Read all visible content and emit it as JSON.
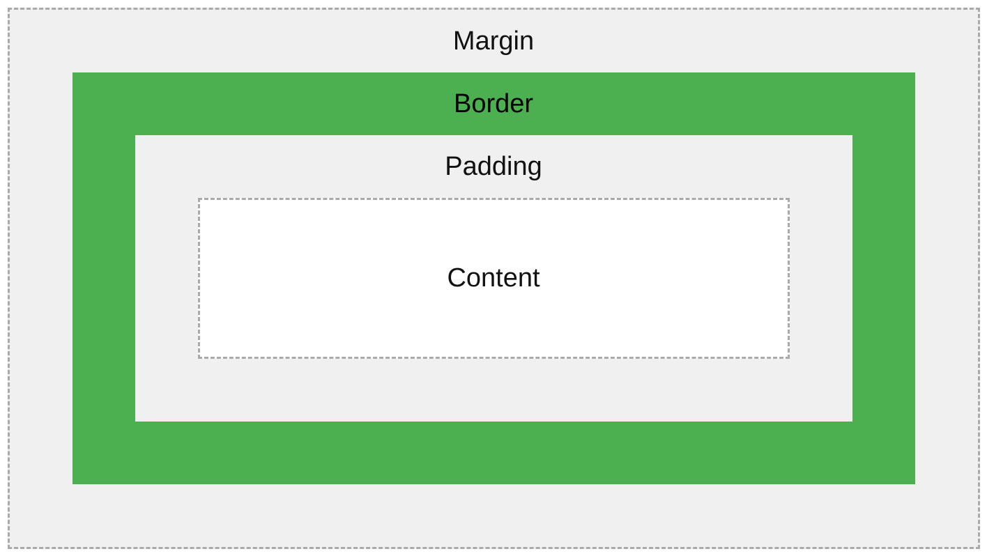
{
  "box_model": {
    "margin": {
      "label": "Margin",
      "color": "#f0f0f0",
      "border_style": "dashed",
      "border_color": "#aaaaaa"
    },
    "border": {
      "label": "Border",
      "color": "#4caf50"
    },
    "padding": {
      "label": "Padding",
      "color": "#f0f0f0"
    },
    "content": {
      "label": "Content",
      "color": "#ffffff",
      "border_style": "dashed",
      "border_color": "#aaaaaa"
    }
  }
}
